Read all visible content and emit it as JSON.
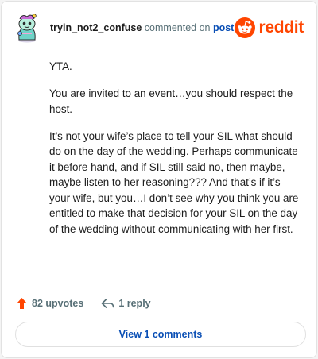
{
  "comment": {
    "username": "tryin_not2_confuse",
    "action_text": " commented on ",
    "post_link": "post",
    "paragraphs": [
      "YTA.",
      "You are invited to an event…you should respect the host.",
      "It’s not your wife’s place to tell your SIL what should do on the day of the wedding. Perhaps communicate it before hand, and if SIL still said no, then maybe, maybe listen to her reasoning??? And that’s if it’s your wife, but you…I don’t see why you think you are entitled to make that decision for your SIL on the day of the wedding without communicating with her first."
    ]
  },
  "brand": {
    "name": "reddit",
    "color": "#ff4500"
  },
  "stats": {
    "upvotes": "82 upvotes",
    "replies": "1 reply"
  },
  "footer": {
    "view_comments_label": "View 1 comments"
  },
  "colors": {
    "link": "#0a4fb5",
    "muted": "#576f76",
    "upvote": "#ff4500"
  },
  "icons": {
    "avatar": "snoo-avatar-icon",
    "brand": "reddit-logo-icon",
    "upvote": "upvote-arrow-icon",
    "reply": "reply-arrow-icon"
  }
}
